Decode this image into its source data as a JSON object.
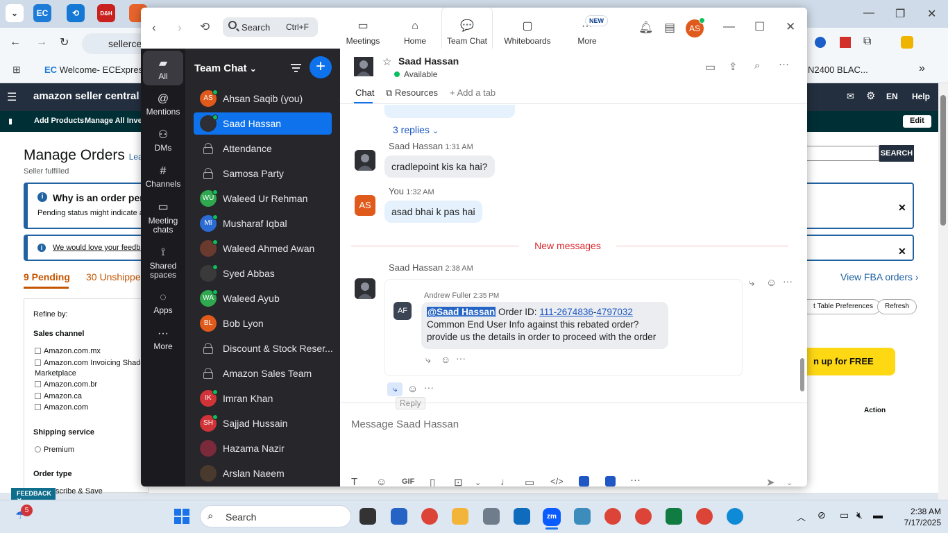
{
  "browser": {
    "address": "sellerce",
    "bookmark_1": "Welcome- ECExpres...",
    "bookmark_2": "N2400 BLAC...",
    "tab_ec": "EC",
    "tab_sis": "D&H"
  },
  "amazon": {
    "logo": "amazon seller central",
    "nav_add_products": "Add Products",
    "nav_manage_inventory": "Manage All Invent",
    "lang": "EN",
    "help": "Help",
    "edit": "Edit",
    "search_button": "SEARCH",
    "title": "Manage Orders",
    "title_link": "Lear",
    "subtitle": "Seller fulfilled",
    "info_title": "Why is an order pen",
    "info_body": "Pending status might indicate a",
    "feedback_link": "We would love your feedba",
    "pending_tab": "9 Pending",
    "unshipped_tab": "30 Unshipped",
    "view_fba": "View FBA orders",
    "table_prefs": "t Table Preferences",
    "refresh": "Refresh",
    "signup": "n up for FREE",
    "action_col": "Action",
    "refine_by": "Refine by:",
    "sales_channel": "Sales channel",
    "channels": [
      "Amazon.com.mx",
      "Amazon.com Invoicing Shado",
      "Marketplace",
      "Amazon.com.br",
      "Amazon.ca",
      "Amazon.com"
    ],
    "shipping_service": "Shipping service",
    "premium": "Premium",
    "order_type": "Order type",
    "subscribe_save": "scribe & Save",
    "feedback_tag": "FEEDBACK"
  },
  "zoom": {
    "search_placeholder": "Search",
    "search_shortcut": "Ctrl+F",
    "nav_tabs": [
      {
        "label": "Meetings"
      },
      {
        "label": "Home"
      },
      {
        "label": "Team Chat"
      },
      {
        "label": "Whiteboards"
      },
      {
        "label": "More"
      }
    ],
    "new_badge": "NEW",
    "user_initials": "AS",
    "rail": [
      {
        "label": "All"
      },
      {
        "label": "Mentions"
      },
      {
        "label": "DMs"
      },
      {
        "label": "Channels"
      },
      {
        "label": "Meeting chats"
      },
      {
        "label": "Shared spaces"
      },
      {
        "label": "Apps"
      },
      {
        "label": "More"
      }
    ],
    "list_title": "Team Chat",
    "contacts": [
      {
        "name": "Ahsan Saqib (you)",
        "initials": "AS",
        "color": "#e05a1c"
      },
      {
        "name": "Saad Hassan",
        "initials": "",
        "color": "#2e2e35"
      },
      {
        "name": "Attendance",
        "initials": "",
        "color": ""
      },
      {
        "name": "Samosa Party",
        "initials": "",
        "color": ""
      },
      {
        "name": "Waleed Ur Rehman",
        "initials": "WU",
        "color": "#2fa84f"
      },
      {
        "name": "Musharaf Iqbal",
        "initials": "MI",
        "color": "#2b6cd4"
      },
      {
        "name": "Waleed Ahmed Awan",
        "initials": "",
        "color": "#6b3a2e"
      },
      {
        "name": "Syed Abbas",
        "initials": "",
        "color": "#3a3a3a"
      },
      {
        "name": "Waleed Ayub",
        "initials": "WA",
        "color": "#2fa84f"
      },
      {
        "name": "Bob Lyon",
        "initials": "BL",
        "color": "#e05a1c"
      },
      {
        "name": "Discount & Stock Reser...",
        "initials": "",
        "color": ""
      },
      {
        "name": "Amazon Sales Team",
        "initials": "",
        "color": ""
      },
      {
        "name": "Imran Khan",
        "initials": "IK",
        "color": "#d13438"
      },
      {
        "name": "Sajjad Hussain",
        "initials": "SH",
        "color": "#d13438"
      },
      {
        "name": "Hazama Nazir",
        "initials": "",
        "color": "#7a2a3a"
      },
      {
        "name": "Arslan Naeem",
        "initials": "",
        "color": "#4a3a2e"
      }
    ],
    "chat": {
      "name": "Saad Hassan",
      "status": "Available",
      "tabs": {
        "chat": "Chat",
        "resources": "Resources",
        "add": "Add a tab"
      },
      "replies": "3 replies",
      "messages": [
        {
          "author": "Saad Hassan",
          "time": "1:31 AM",
          "text": "cradlepoint kis ka hai?"
        },
        {
          "author": "You",
          "time": "1:32 AM",
          "text": "asad bhai k pas hai"
        }
      ],
      "new_messages": "New messages",
      "last_author": "Saad Hassan",
      "last_time": "2:38 AM",
      "quoted": {
        "initials": "AF",
        "author": "Andrew Fuller",
        "time": "2:35 PM",
        "mention": "@Saad Hassan",
        "order_label": "Order ID:",
        "order_part1": "111-2674836",
        "order_dash": "-",
        "order_part2": "4797032",
        "line2": "Common End User Info against this rebated order?",
        "line3": "provide us the details in order to proceed with the order"
      },
      "tooltip": "Reply",
      "compose_placeholder": "Message Saad Hassan",
      "gif": "GIF"
    }
  },
  "taskbar": {
    "search": "Search",
    "time": "2:38 AM",
    "date": "7/17/2025",
    "weather_badge": "5"
  }
}
